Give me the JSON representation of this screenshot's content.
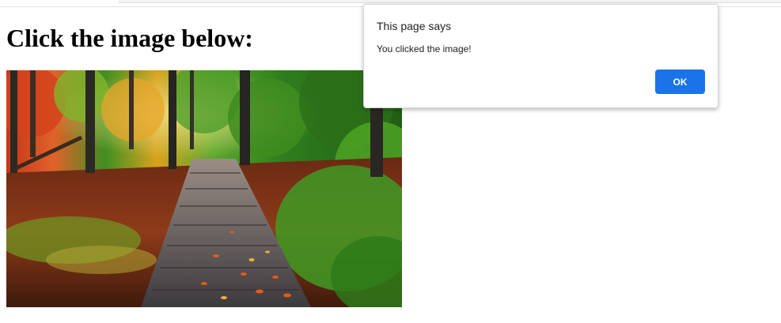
{
  "page": {
    "heading": "Click the image below:"
  },
  "image": {
    "alt": "Autumn forest boardwalk"
  },
  "dialog": {
    "title": "This page says",
    "message": "You clicked the image!",
    "ok_label": "OK",
    "accent": "#1a73e8"
  }
}
